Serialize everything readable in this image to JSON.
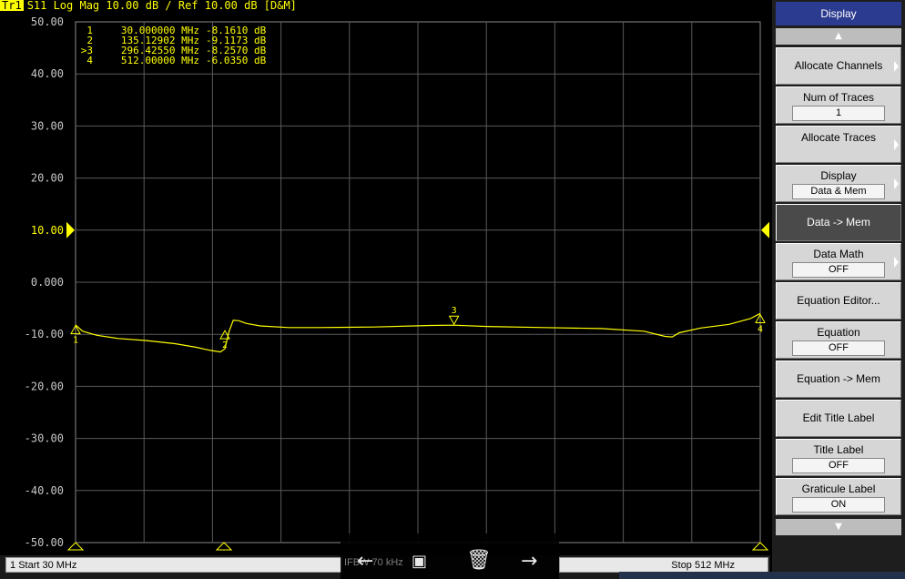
{
  "title_bar": {
    "trace_id": "Tr1",
    "text": "S11 Log Mag 10.00 dB / Ref 10.00 dB [D&M]"
  },
  "markers_readout": [
    {
      "id": "1",
      "freq": "30.000000 MHz",
      "value": "-8.1610 dB"
    },
    {
      "id": "2",
      "freq": "135.12902 MHz",
      "value": "-9.1173 dB"
    },
    {
      "id": ">3",
      "freq": "296.42550 MHz",
      "value": "-8.2570 dB"
    },
    {
      "id": "4",
      "freq": "512.00000 MHz",
      "value": "-6.0350 dB"
    }
  ],
  "y_ticks": [
    "50.00",
    "40.00",
    "30.00",
    "20.00",
    "10.00",
    "0.000",
    "-10.00",
    "-20.00",
    "-30.00",
    "-40.00",
    "-50.00"
  ],
  "ref_level_label": "10.00",
  "chart_data": {
    "type": "line",
    "ylim": [
      -50,
      50
    ],
    "xlim": [
      30,
      512
    ],
    "grid": true,
    "series": [
      {
        "x": [
          30,
          35,
          45,
          60,
          80,
          100,
          115,
          125,
          132,
          135.1,
          138,
          141,
          145,
          150,
          160,
          180,
          200,
          240,
          280,
          296.4,
          320,
          360,
          400,
          430,
          445,
          450,
          455,
          470,
          490,
          505,
          512
        ],
        "y": [
          -8.2,
          -9.4,
          -10.2,
          -10.8,
          -11.2,
          -11.8,
          -12.5,
          -13.1,
          -13.4,
          -12.8,
          -9.5,
          -7.3,
          -7.4,
          -7.9,
          -8.4,
          -8.7,
          -8.7,
          -8.6,
          -8.3,
          -8.26,
          -8.5,
          -8.7,
          -8.9,
          -9.4,
          -10.4,
          -10.5,
          -9.7,
          -8.8,
          -8.1,
          -7.0,
          -6.0
        ]
      }
    ],
    "markers": [
      {
        "label": "1",
        "x": 30,
        "y": -8.161
      },
      {
        "label": "2",
        "x": 135.12902,
        "y": -9.1173
      },
      {
        "label": "3",
        "x": 296.4255,
        "y": -8.257
      },
      {
        "label": "4",
        "x": 512,
        "y": -6.035
      }
    ]
  },
  "status": {
    "channel": "1",
    "start": "Start 30 MHz",
    "stop": "Stop 512 MHz",
    "ifbw": "IFBW 70 kHz"
  },
  "softkeys": {
    "title": "Display",
    "buttons": [
      {
        "label": "Allocate Channels",
        "value": "",
        "submenu": true
      },
      {
        "label": "Num of Traces",
        "value": "1",
        "submenu": false
      },
      {
        "label": "Allocate Traces",
        "value": "",
        "submenu": true
      },
      {
        "label": "Display",
        "value": "Data & Mem",
        "submenu": true
      },
      {
        "label": "Data -> Mem",
        "value": "",
        "submenu": false,
        "dark": true
      },
      {
        "label": "Data Math",
        "value": "OFF",
        "submenu": true
      },
      {
        "label": "Equation Editor...",
        "value": "",
        "submenu": false
      },
      {
        "label": "Equation",
        "value": "OFF",
        "submenu": false
      },
      {
        "label": "Equation -> Mem",
        "value": "",
        "submenu": false
      },
      {
        "label": "Edit Title Label",
        "value": "",
        "submenu": false
      },
      {
        "label": "Title Label",
        "value": "OFF",
        "submenu": false
      },
      {
        "label": "Graticule Label",
        "value": "ON",
        "submenu": false
      }
    ]
  },
  "colors": {
    "trace": "#ffff00",
    "grid": "#5a5a5a",
    "background": "#000000",
    "softkey_title": "#2b3b8f"
  }
}
